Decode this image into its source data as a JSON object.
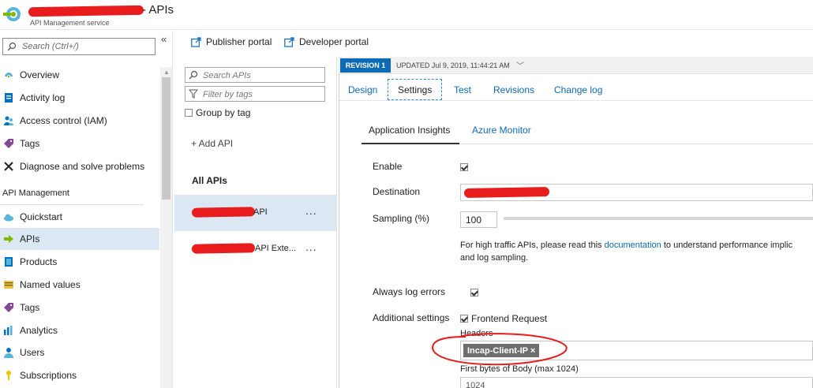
{
  "header": {
    "title": " - APIs",
    "subtitle": "API Management service"
  },
  "nav": {
    "search_placeholder": "Search (Ctrl+/)",
    "collapse_glyph": "«",
    "items": [
      {
        "label": "Overview",
        "icon": "overview-icon"
      },
      {
        "label": "Activity log",
        "icon": "activity-log-icon"
      },
      {
        "label": "Access control (IAM)",
        "icon": "iam-icon"
      },
      {
        "label": "Tags",
        "icon": "tag-icon"
      },
      {
        "label": "Diagnose and solve problems",
        "icon": "wrench-icon"
      }
    ],
    "section_title": "API Management",
    "section_items": [
      {
        "label": "Quickstart",
        "icon": "cloud-icon"
      },
      {
        "label": "APIs",
        "icon": "api-arrow-icon",
        "active": true
      },
      {
        "label": "Products",
        "icon": "products-icon"
      },
      {
        "label": "Named values",
        "icon": "named-values-icon"
      },
      {
        "label": "Tags",
        "icon": "tag-icon"
      },
      {
        "label": "Analytics",
        "icon": "analytics-icon"
      },
      {
        "label": "Users",
        "icon": "users-icon"
      },
      {
        "label": "Subscriptions",
        "icon": "key-icon"
      }
    ]
  },
  "toolbar": {
    "publisher_portal": "Publisher portal",
    "developer_portal": "Developer portal"
  },
  "api_list": {
    "search_placeholder": "Search APIs",
    "filter_placeholder": "Filter by tags",
    "group_by_tag": "Group by tag",
    "add_api": "+ Add API",
    "all_apis": "All APIs",
    "apis": [
      {
        "name": "API",
        "selected": true
      },
      {
        "name": "API Exte...",
        "selected": false
      }
    ],
    "more_glyph": "..."
  },
  "revision": {
    "badge": "REVISION 1",
    "updated": "UPDATED Jul 9, 2019, 11:44:21 AM"
  },
  "tabs": [
    "Design",
    "Settings",
    "Test",
    "Revisions",
    "Change log"
  ],
  "selected_tab": "Settings",
  "subtabs": [
    "Application Insights",
    "Azure Monitor"
  ],
  "settings": {
    "enable_label": "Enable",
    "enable_checked": true,
    "destination_label": "Destination",
    "sampling_label": "Sampling (%)",
    "sampling_value": "100",
    "help_prefix": "For high traffic APIs, please read this ",
    "help_link": "documentation",
    "help_suffix": " to understand performance implic",
    "help_line2": "and log sampling.",
    "always_log_label": "Always log errors",
    "always_log_checked": true,
    "additional_label": "Additional settings",
    "frontend_request_label": "Frontend Request",
    "frontend_request_checked": true,
    "headers_label": "Headers",
    "header_tag": "Incap-Client-IP ×",
    "first_bytes_label": "First bytes of Body (max 1024)",
    "first_bytes_value": "1024"
  },
  "colors": {
    "accent": "#0d6ab4",
    "selected_bg": "#dbe8f4",
    "redaction": "#e81c1c",
    "annotation": "#e81c1c"
  }
}
